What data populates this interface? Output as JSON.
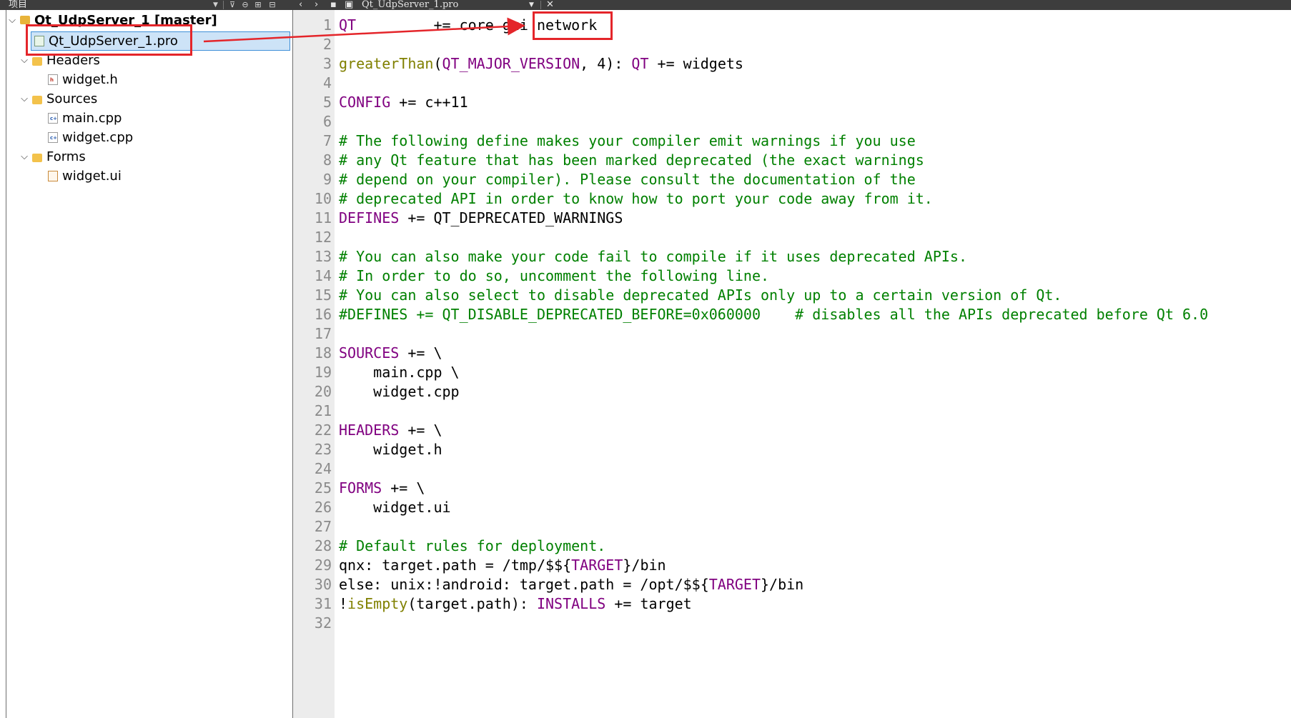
{
  "project_panel": {
    "title": "项目",
    "tree": {
      "project": "Qt_UdpServer_1 [master]",
      "pro_file": "Qt_UdpServer_1.pro",
      "headers": {
        "label": "Headers",
        "files": [
          "widget.h"
        ]
      },
      "sources": {
        "label": "Sources",
        "files": [
          "main.cpp",
          "widget.cpp"
        ]
      },
      "forms": {
        "label": "Forms",
        "files": [
          "widget.ui"
        ]
      }
    }
  },
  "editor": {
    "tab_title": "Qt_UdpServer_1.pro",
    "lines": [
      {
        "n": "1",
        "segs": [
          {
            "t": "QT",
            "c": "kw"
          },
          {
            "t": "         += core gui ",
            "c": ""
          },
          {
            "t": "network",
            "c": ""
          }
        ]
      },
      {
        "n": "2",
        "segs": []
      },
      {
        "n": "3",
        "segs": [
          {
            "t": "greaterThan",
            "c": "fn"
          },
          {
            "t": "(",
            "c": ""
          },
          {
            "t": "QT_MAJOR_VERSION",
            "c": "kw"
          },
          {
            "t": ", 4): ",
            "c": ""
          },
          {
            "t": "QT",
            "c": "kw"
          },
          {
            "t": " += widgets",
            "c": ""
          }
        ]
      },
      {
        "n": "4",
        "segs": []
      },
      {
        "n": "5",
        "segs": [
          {
            "t": "CONFIG",
            "c": "kw"
          },
          {
            "t": " += c++11",
            "c": ""
          }
        ]
      },
      {
        "n": "6",
        "segs": []
      },
      {
        "n": "7",
        "segs": [
          {
            "t": "# The following define makes your compiler emit warnings if you use",
            "c": "cm"
          }
        ]
      },
      {
        "n": "8",
        "segs": [
          {
            "t": "# any Qt feature that has been marked deprecated (the exact warnings",
            "c": "cm"
          }
        ]
      },
      {
        "n": "9",
        "segs": [
          {
            "t": "# depend on your compiler). Please consult the documentation of the",
            "c": "cm"
          }
        ]
      },
      {
        "n": "10",
        "segs": [
          {
            "t": "# deprecated API in order to know how to port your code away from it.",
            "c": "cm"
          }
        ]
      },
      {
        "n": "11",
        "segs": [
          {
            "t": "DEFINES",
            "c": "kw"
          },
          {
            "t": " += QT_DEPRECATED_WARNINGS",
            "c": ""
          }
        ]
      },
      {
        "n": "12",
        "segs": []
      },
      {
        "n": "13",
        "segs": [
          {
            "t": "# You can also make your code fail to compile if it uses deprecated APIs.",
            "c": "cm"
          }
        ]
      },
      {
        "n": "14",
        "segs": [
          {
            "t": "# In order to do so, uncomment the following line.",
            "c": "cm"
          }
        ]
      },
      {
        "n": "15",
        "segs": [
          {
            "t": "# You can also select to disable deprecated APIs only up to a certain version of Qt.",
            "c": "cm"
          }
        ]
      },
      {
        "n": "16",
        "segs": [
          {
            "t": "#DEFINES += QT_DISABLE_DEPRECATED_BEFORE=0x060000    # disables all the APIs deprecated before Qt 6.0",
            "c": "cm"
          }
        ]
      },
      {
        "n": "17",
        "segs": []
      },
      {
        "n": "18",
        "segs": [
          {
            "t": "SOURCES",
            "c": "kw"
          },
          {
            "t": " += \\",
            "c": ""
          }
        ]
      },
      {
        "n": "19",
        "segs": [
          {
            "t": "    main.cpp \\",
            "c": ""
          }
        ]
      },
      {
        "n": "20",
        "segs": [
          {
            "t": "    widget.cpp",
            "c": ""
          }
        ]
      },
      {
        "n": "21",
        "segs": []
      },
      {
        "n": "22",
        "segs": [
          {
            "t": "HEADERS",
            "c": "kw"
          },
          {
            "t": " += \\",
            "c": ""
          }
        ]
      },
      {
        "n": "23",
        "segs": [
          {
            "t": "    widget.h",
            "c": ""
          }
        ]
      },
      {
        "n": "24",
        "segs": []
      },
      {
        "n": "25",
        "segs": [
          {
            "t": "FORMS",
            "c": "kw"
          },
          {
            "t": " += \\",
            "c": ""
          }
        ]
      },
      {
        "n": "26",
        "segs": [
          {
            "t": "    widget.ui",
            "c": ""
          }
        ]
      },
      {
        "n": "27",
        "segs": []
      },
      {
        "n": "28",
        "segs": [
          {
            "t": "# Default rules for deployment.",
            "c": "cm"
          }
        ]
      },
      {
        "n": "29",
        "segs": [
          {
            "t": "qnx: target.path = /tmp/$${",
            "c": ""
          },
          {
            "t": "TARGET",
            "c": "kw"
          },
          {
            "t": "}/bin",
            "c": ""
          }
        ]
      },
      {
        "n": "30",
        "segs": [
          {
            "t": "else: unix:!android: target.path = /opt/$${",
            "c": ""
          },
          {
            "t": "TARGET",
            "c": "kw"
          },
          {
            "t": "}/bin",
            "c": ""
          }
        ]
      },
      {
        "n": "31",
        "segs": [
          {
            "t": "!",
            "c": ""
          },
          {
            "t": "isEmpty",
            "c": "fn"
          },
          {
            "t": "(target.path): ",
            "c": ""
          },
          {
            "t": "INSTALLS",
            "c": "kw"
          },
          {
            "t": " += target",
            "c": ""
          }
        ]
      },
      {
        "n": "32",
        "segs": []
      }
    ]
  },
  "colors": {
    "annotation_red": "#e4252a",
    "keyword": "#800080",
    "function": "#808000",
    "comment": "#008000",
    "selection": "#cde3f7"
  }
}
